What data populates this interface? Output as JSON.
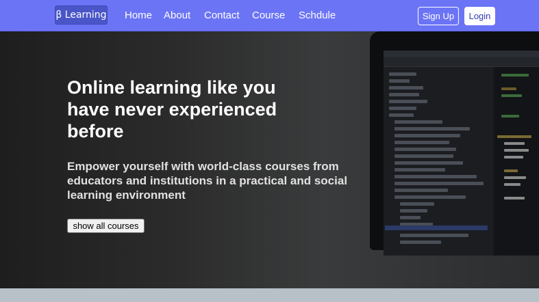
{
  "navbar": {
    "brand": "β Learning",
    "links": [
      "Home",
      "About",
      "Contact",
      "Course",
      "Schdule"
    ],
    "signup_label": "Sign Up",
    "login_label": "Login"
  },
  "hero": {
    "title": "Online learning like you have never experienced before",
    "subtitle": "Empower yourself with world-class courses from educators and institutions in a practical and social learning environment",
    "cta_label": "show all courses"
  },
  "colors": {
    "navbar_bg": "#6b74f5",
    "brand_bg": "#4a56c8",
    "login_text": "#2f3bb0"
  }
}
